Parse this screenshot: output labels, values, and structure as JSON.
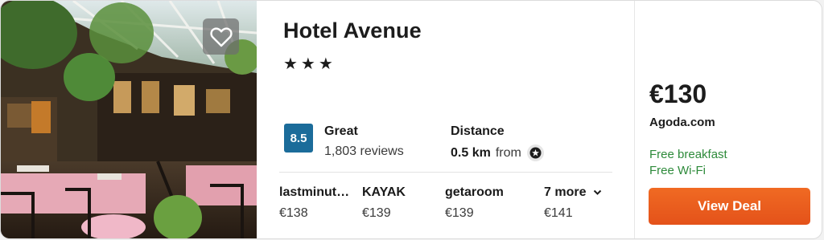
{
  "hotel": {
    "name": "Hotel Avenue",
    "stars": "★★★",
    "favorite_icon": "heart-outline-icon"
  },
  "rating": {
    "score": "8.5",
    "word": "Great",
    "reviews": "1,803 reviews",
    "score_color": "#1b6c9a"
  },
  "distance": {
    "label": "Distance",
    "value": "0.5 km",
    "from": "from",
    "landmark_icon": "star-landmark-icon"
  },
  "providers": [
    {
      "name": "lastminute.com",
      "price": "€138"
    },
    {
      "name": "KAYAK",
      "price": "€139"
    },
    {
      "name": "getaroom",
      "price": "€139"
    }
  ],
  "more": {
    "label": "7 more",
    "price": "€141"
  },
  "deal": {
    "price": "€130",
    "site": "Agoda.com",
    "amenities": [
      "Free breakfast",
      "Free Wi-Fi"
    ],
    "button_label": "View Deal",
    "accent_color": "#e85a1e",
    "amenity_color": "#2d8a3a"
  }
}
